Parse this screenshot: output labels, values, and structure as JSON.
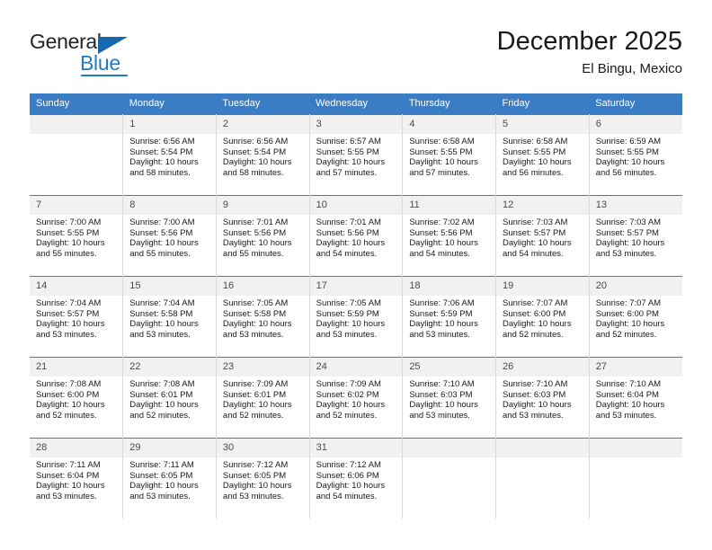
{
  "brand": {
    "name_part1": "General",
    "name_part2": "Blue",
    "logo_icon": "blue-triangle-icon"
  },
  "header": {
    "title": "December 2025",
    "subtitle": "El Bingu, Mexico"
  },
  "calendar": {
    "weekday_headers": [
      "Sunday",
      "Monday",
      "Tuesday",
      "Wednesday",
      "Thursday",
      "Friday",
      "Saturday"
    ],
    "accent_color": "#3b7dc4",
    "daynum_band_color": "#f1f1f1",
    "weeks": [
      [
        {
          "day": "",
          "sunrise": "",
          "sunset": "",
          "daylight1": "",
          "daylight2": ""
        },
        {
          "day": "1",
          "sunrise": "Sunrise: 6:56 AM",
          "sunset": "Sunset: 5:54 PM",
          "daylight1": "Daylight: 10 hours",
          "daylight2": "and 58 minutes."
        },
        {
          "day": "2",
          "sunrise": "Sunrise: 6:56 AM",
          "sunset": "Sunset: 5:54 PM",
          "daylight1": "Daylight: 10 hours",
          "daylight2": "and 58 minutes."
        },
        {
          "day": "3",
          "sunrise": "Sunrise: 6:57 AM",
          "sunset": "Sunset: 5:55 PM",
          "daylight1": "Daylight: 10 hours",
          "daylight2": "and 57 minutes."
        },
        {
          "day": "4",
          "sunrise": "Sunrise: 6:58 AM",
          "sunset": "Sunset: 5:55 PM",
          "daylight1": "Daylight: 10 hours",
          "daylight2": "and 57 minutes."
        },
        {
          "day": "5",
          "sunrise": "Sunrise: 6:58 AM",
          "sunset": "Sunset: 5:55 PM",
          "daylight1": "Daylight: 10 hours",
          "daylight2": "and 56 minutes."
        },
        {
          "day": "6",
          "sunrise": "Sunrise: 6:59 AM",
          "sunset": "Sunset: 5:55 PM",
          "daylight1": "Daylight: 10 hours",
          "daylight2": "and 56 minutes."
        }
      ],
      [
        {
          "day": "7",
          "sunrise": "Sunrise: 7:00 AM",
          "sunset": "Sunset: 5:55 PM",
          "daylight1": "Daylight: 10 hours",
          "daylight2": "and 55 minutes."
        },
        {
          "day": "8",
          "sunrise": "Sunrise: 7:00 AM",
          "sunset": "Sunset: 5:56 PM",
          "daylight1": "Daylight: 10 hours",
          "daylight2": "and 55 minutes."
        },
        {
          "day": "9",
          "sunrise": "Sunrise: 7:01 AM",
          "sunset": "Sunset: 5:56 PM",
          "daylight1": "Daylight: 10 hours",
          "daylight2": "and 55 minutes."
        },
        {
          "day": "10",
          "sunrise": "Sunrise: 7:01 AM",
          "sunset": "Sunset: 5:56 PM",
          "daylight1": "Daylight: 10 hours",
          "daylight2": "and 54 minutes."
        },
        {
          "day": "11",
          "sunrise": "Sunrise: 7:02 AM",
          "sunset": "Sunset: 5:56 PM",
          "daylight1": "Daylight: 10 hours",
          "daylight2": "and 54 minutes."
        },
        {
          "day": "12",
          "sunrise": "Sunrise: 7:03 AM",
          "sunset": "Sunset: 5:57 PM",
          "daylight1": "Daylight: 10 hours",
          "daylight2": "and 54 minutes."
        },
        {
          "day": "13",
          "sunrise": "Sunrise: 7:03 AM",
          "sunset": "Sunset: 5:57 PM",
          "daylight1": "Daylight: 10 hours",
          "daylight2": "and 53 minutes."
        }
      ],
      [
        {
          "day": "14",
          "sunrise": "Sunrise: 7:04 AM",
          "sunset": "Sunset: 5:57 PM",
          "daylight1": "Daylight: 10 hours",
          "daylight2": "and 53 minutes."
        },
        {
          "day": "15",
          "sunrise": "Sunrise: 7:04 AM",
          "sunset": "Sunset: 5:58 PM",
          "daylight1": "Daylight: 10 hours",
          "daylight2": "and 53 minutes."
        },
        {
          "day": "16",
          "sunrise": "Sunrise: 7:05 AM",
          "sunset": "Sunset: 5:58 PM",
          "daylight1": "Daylight: 10 hours",
          "daylight2": "and 53 minutes."
        },
        {
          "day": "17",
          "sunrise": "Sunrise: 7:05 AM",
          "sunset": "Sunset: 5:59 PM",
          "daylight1": "Daylight: 10 hours",
          "daylight2": "and 53 minutes."
        },
        {
          "day": "18",
          "sunrise": "Sunrise: 7:06 AM",
          "sunset": "Sunset: 5:59 PM",
          "daylight1": "Daylight: 10 hours",
          "daylight2": "and 53 minutes."
        },
        {
          "day": "19",
          "sunrise": "Sunrise: 7:07 AM",
          "sunset": "Sunset: 6:00 PM",
          "daylight1": "Daylight: 10 hours",
          "daylight2": "and 52 minutes."
        },
        {
          "day": "20",
          "sunrise": "Sunrise: 7:07 AM",
          "sunset": "Sunset: 6:00 PM",
          "daylight1": "Daylight: 10 hours",
          "daylight2": "and 52 minutes."
        }
      ],
      [
        {
          "day": "21",
          "sunrise": "Sunrise: 7:08 AM",
          "sunset": "Sunset: 6:00 PM",
          "daylight1": "Daylight: 10 hours",
          "daylight2": "and 52 minutes."
        },
        {
          "day": "22",
          "sunrise": "Sunrise: 7:08 AM",
          "sunset": "Sunset: 6:01 PM",
          "daylight1": "Daylight: 10 hours",
          "daylight2": "and 52 minutes."
        },
        {
          "day": "23",
          "sunrise": "Sunrise: 7:09 AM",
          "sunset": "Sunset: 6:01 PM",
          "daylight1": "Daylight: 10 hours",
          "daylight2": "and 52 minutes."
        },
        {
          "day": "24",
          "sunrise": "Sunrise: 7:09 AM",
          "sunset": "Sunset: 6:02 PM",
          "daylight1": "Daylight: 10 hours",
          "daylight2": "and 52 minutes."
        },
        {
          "day": "25",
          "sunrise": "Sunrise: 7:10 AM",
          "sunset": "Sunset: 6:03 PM",
          "daylight1": "Daylight: 10 hours",
          "daylight2": "and 53 minutes."
        },
        {
          "day": "26",
          "sunrise": "Sunrise: 7:10 AM",
          "sunset": "Sunset: 6:03 PM",
          "daylight1": "Daylight: 10 hours",
          "daylight2": "and 53 minutes."
        },
        {
          "day": "27",
          "sunrise": "Sunrise: 7:10 AM",
          "sunset": "Sunset: 6:04 PM",
          "daylight1": "Daylight: 10 hours",
          "daylight2": "and 53 minutes."
        }
      ],
      [
        {
          "day": "28",
          "sunrise": "Sunrise: 7:11 AM",
          "sunset": "Sunset: 6:04 PM",
          "daylight1": "Daylight: 10 hours",
          "daylight2": "and 53 minutes."
        },
        {
          "day": "29",
          "sunrise": "Sunrise: 7:11 AM",
          "sunset": "Sunset: 6:05 PM",
          "daylight1": "Daylight: 10 hours",
          "daylight2": "and 53 minutes."
        },
        {
          "day": "30",
          "sunrise": "Sunrise: 7:12 AM",
          "sunset": "Sunset: 6:05 PM",
          "daylight1": "Daylight: 10 hours",
          "daylight2": "and 53 minutes."
        },
        {
          "day": "31",
          "sunrise": "Sunrise: 7:12 AM",
          "sunset": "Sunset: 6:06 PM",
          "daylight1": "Daylight: 10 hours",
          "daylight2": "and 54 minutes."
        },
        {
          "day": "",
          "sunrise": "",
          "sunset": "",
          "daylight1": "",
          "daylight2": ""
        },
        {
          "day": "",
          "sunrise": "",
          "sunset": "",
          "daylight1": "",
          "daylight2": ""
        },
        {
          "day": "",
          "sunrise": "",
          "sunset": "",
          "daylight1": "",
          "daylight2": ""
        }
      ]
    ]
  }
}
